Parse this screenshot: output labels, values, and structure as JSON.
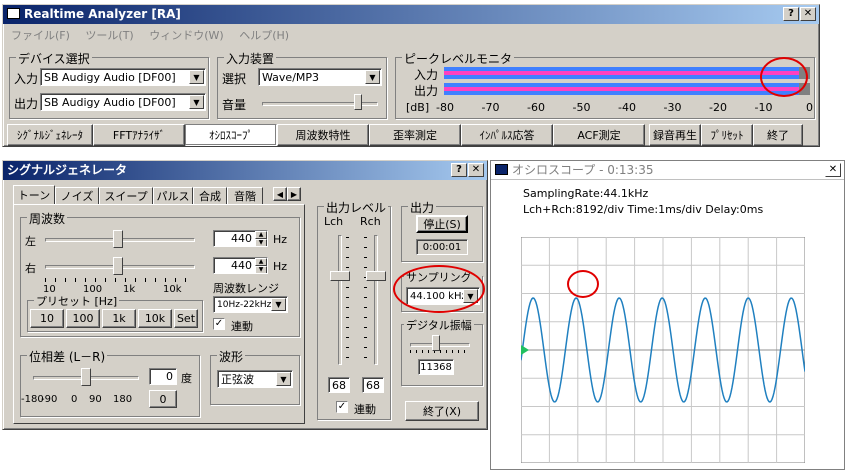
{
  "main": {
    "title": "Realtime Analyzer [RA]",
    "menu": [
      "ファイル(F)",
      "ツール(T)",
      "ウィンドウ(W)",
      "ヘルプ(H)"
    ],
    "device_group": "デバイス選択",
    "input_label": "入力",
    "input_value": "SB Audigy Audio [DF00]",
    "output_label": "出力",
    "output_value": "SB Audigy Audio [DF00]",
    "io_group": "入力装置",
    "select_label": "選択",
    "select_value": "Wave/MP3",
    "volume_label": "音量",
    "volume_level": 0.85,
    "peak_group": "ピークレベルモニタ",
    "peak_in_label": "入力",
    "peak_out_label": "出力",
    "db_label": "[dB]",
    "db_ticks": [
      "-80",
      "-70",
      "-60",
      "-50",
      "-40",
      "-30",
      "-20",
      "-10",
      "0"
    ],
    "peak_in_level": 0.97,
    "peak_out_level": 0.97,
    "tabs": [
      "ｼｸﾞﾅﾙｼﾞｪﾈﾚｰﾀ",
      "FFTｱﾅﾗｲｻﾞ",
      "ｵｼﾛｽｺｰﾌﾟ",
      "周波数特性",
      "歪率測定",
      "ｲﾝﾊﾟﾙｽ応答",
      "ACF測定",
      "録音再生",
      "ﾌﾟﾘｾｯﾄ",
      "終了"
    ]
  },
  "siggen": {
    "title": "シグナルジェネレータ",
    "tabs": [
      "トーン",
      "ノイズ",
      "スイープ",
      "パルス",
      "合成",
      "音階"
    ],
    "freq_group": "周波数",
    "left_label": "左",
    "right_label": "右",
    "left_value": "440",
    "right_value": "440",
    "hz": "Hz",
    "freq_ticks": [
      "10",
      "100",
      "1k",
      "10k"
    ],
    "range_label": "周波数レンジ",
    "range_value": "10Hz-22kHz",
    "link_label": "連動",
    "preset_group": "プリセット [Hz]",
    "presets": [
      "10",
      "100",
      "1k",
      "10k",
      "Set"
    ],
    "phase_group": "位相差 (L－R)",
    "phase_value": "0",
    "phase_unit": "度",
    "phase_ticks": [
      "-180",
      "-90",
      "0",
      "90",
      "180"
    ],
    "phase_reset": "0",
    "wave_group": "波形",
    "wave_value": "正弦波",
    "level_group": "出力レベル",
    "lch": "Lch",
    "rch": "Rch",
    "lch_value": "68",
    "rch_value": "68",
    "level_link": "連動",
    "output_group": "出力",
    "stop_button": "停止(S)",
    "time": "0:00:01",
    "rate_group": "サンプリング速度",
    "rate_value": "44.100 kHz",
    "bit_group": "デジタル振幅",
    "bit_value": "11368",
    "close_button": "終了(X)"
  },
  "scope": {
    "title": "オシロスコープ - 0:13:35",
    "line1": "SamplingRate:44.1kHz",
    "line2": "Lch+Rch:8192/div   Time:1ms/div   Delay:0ms",
    "cycles": 6.6
  },
  "colors": {
    "accent": "#0a246a",
    "peak_blue": "#4080ff",
    "peak_pink": "#ff40c0",
    "wave": "#2080c0",
    "marker": "#20c060",
    "highlight": "#e00000"
  }
}
